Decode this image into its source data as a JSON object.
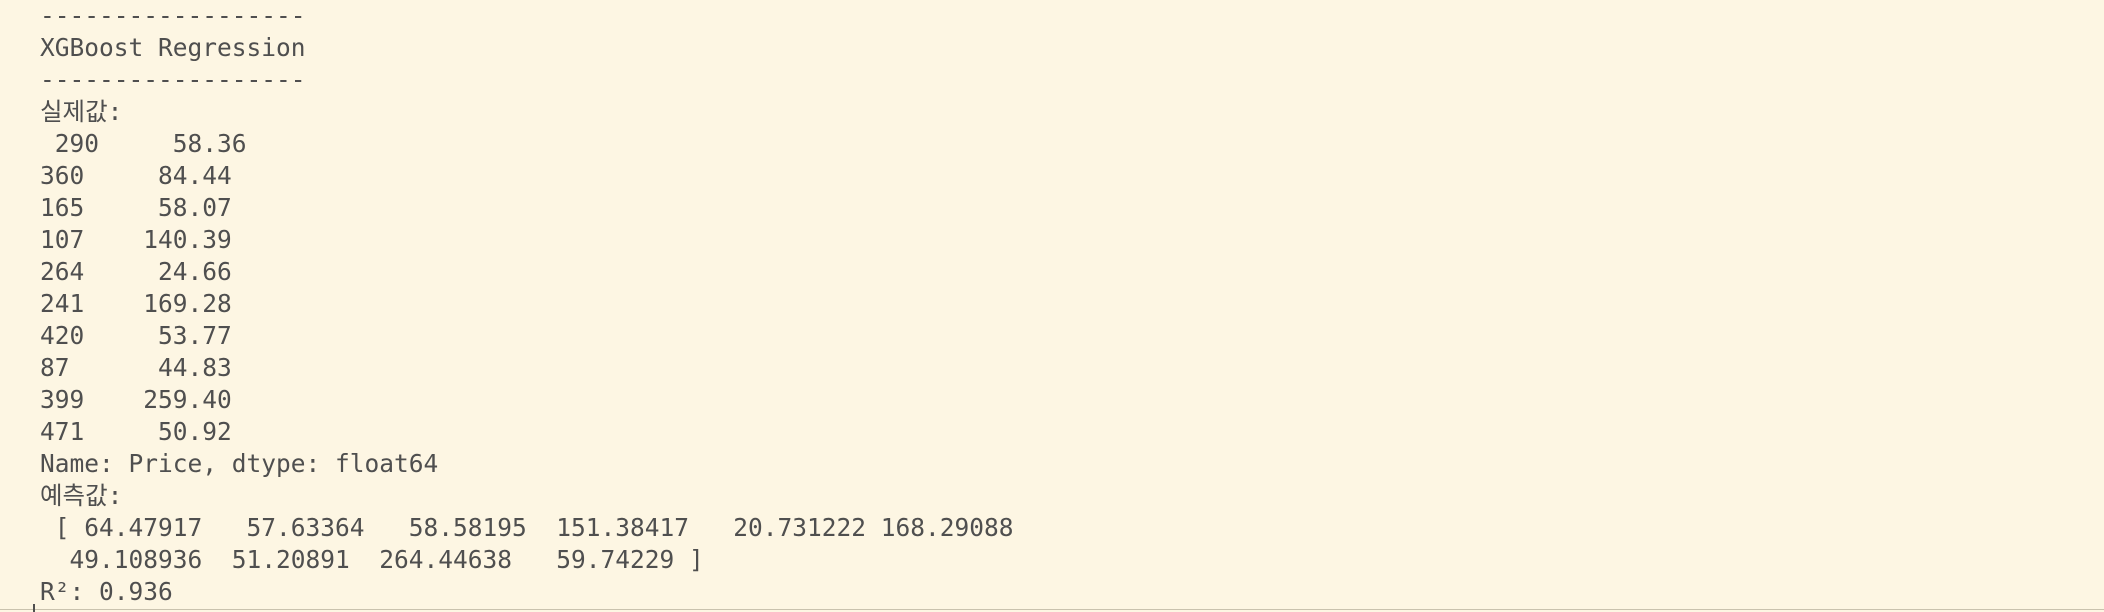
{
  "output": {
    "separator_top": "------------------",
    "title": "XGBoost Regression",
    "separator_bottom": "------------------",
    "actual_label": "실제값:",
    "actual_rows": [
      " 290     58.36",
      "360     84.44",
      "165     58.07",
      "107    140.39",
      "264     24.66",
      "241    169.28",
      "420     53.77",
      "87      44.83",
      "399    259.40",
      "471     50.92"
    ],
    "series_info": "Name: Price, dtype: float64",
    "predicted_label": "예측값:",
    "predicted_lines": [
      " [ 64.47917   57.63364   58.58195  151.38417   20.731222 168.29088",
      "  49.108936  51.20891  264.44638   59.74229 ]"
    ],
    "r2": "R²: 0.936"
  }
}
